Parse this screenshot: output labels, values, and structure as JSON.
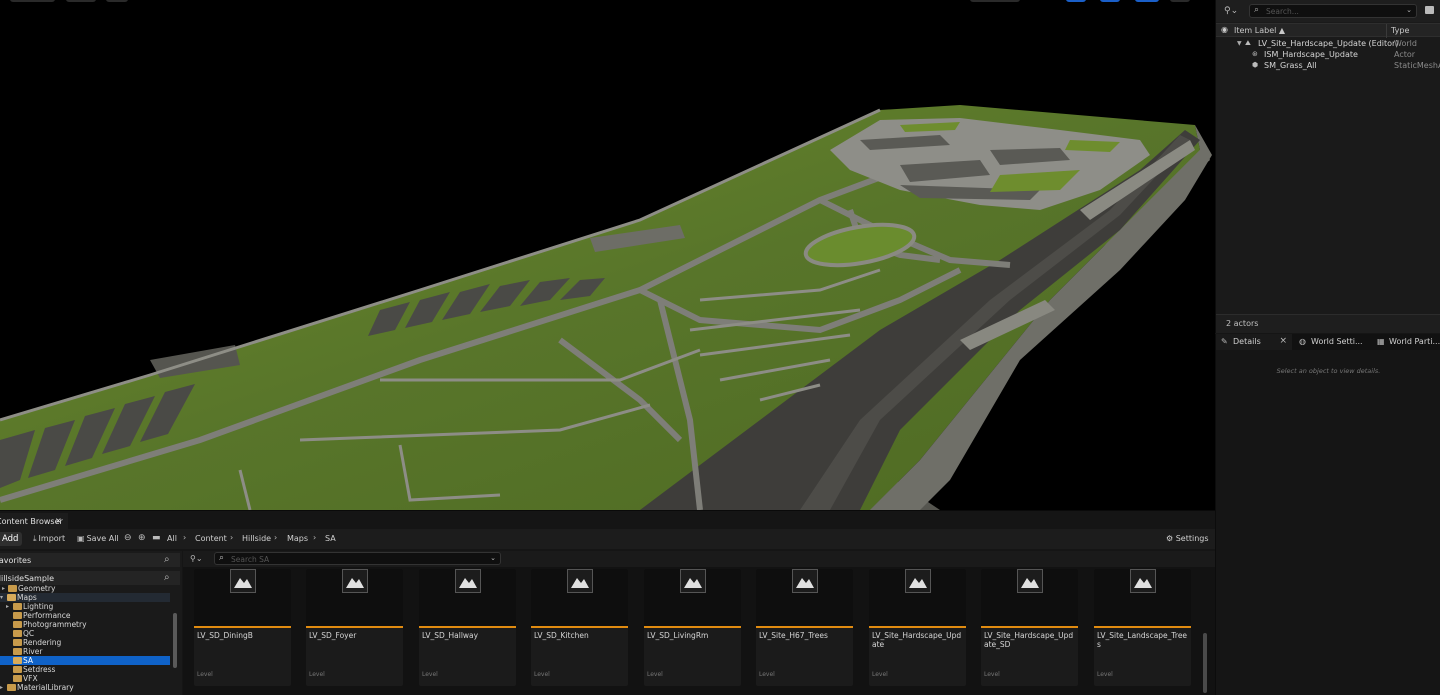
{
  "outliner": {
    "search_placeholder": "Search...",
    "col_label": "Item Label ▲",
    "col_type": "Type",
    "rows": [
      {
        "name": "LV_Site_Hardscape_Update (Editor)",
        "type": "World",
        "icon": "world-icon"
      },
      {
        "name": "ISM_Hardscape_Update",
        "type": "Actor",
        "icon": "actor-icon"
      },
      {
        "name": "SM_Grass_All",
        "type": "StaticMeshAc",
        "icon": "static-mesh-icon"
      }
    ],
    "footer": "2 actors"
  },
  "details": {
    "tabs": [
      {
        "label": "Details",
        "icon": "pencil-icon",
        "close": "×"
      },
      {
        "label": "World Setti...",
        "icon": "globe-icon"
      },
      {
        "label": "World Parti...",
        "icon": "grid-icon"
      }
    ],
    "empty_message": "Select an object to view details."
  },
  "content_browser": {
    "tab_title": "Content Browser",
    "tab_close": "×",
    "add_label": "Add",
    "import_label": "Import",
    "save_all_label": "Save All",
    "breadcrumbs": [
      "All",
      "Content",
      "Hillside",
      "Maps",
      "SA"
    ],
    "settings_label": "Settings",
    "search_placeholder": "Search SA",
    "favorites_label": "Favorites",
    "project_label": "HillsideSample",
    "tree": [
      {
        "name": "Geometry",
        "arrow": "▸",
        "selected": false
      },
      {
        "name": "Maps",
        "arrow": "▾",
        "selected": false,
        "open": true
      },
      {
        "name": "Lighting",
        "arrow": "▸",
        "selected": false
      },
      {
        "name": "Performance",
        "arrow": "",
        "selected": false
      },
      {
        "name": "Photogrammetry",
        "arrow": "",
        "selected": false
      },
      {
        "name": "QC",
        "arrow": "",
        "selected": false
      },
      {
        "name": "Rendering",
        "arrow": "",
        "selected": false
      },
      {
        "name": "River",
        "arrow": "",
        "selected": false
      },
      {
        "name": "SA",
        "arrow": "",
        "selected": true
      },
      {
        "name": "Setdress",
        "arrow": "",
        "selected": false
      },
      {
        "name": "VFX",
        "arrow": "",
        "selected": false
      },
      {
        "name": "MaterialLibrary",
        "arrow": "▸",
        "selected": false
      }
    ],
    "assets": [
      {
        "name": "LV_SD_DiningB",
        "type": "Level"
      },
      {
        "name": "LV_SD_Foyer",
        "type": "Level"
      },
      {
        "name": "LV_SD_Hallway",
        "type": "Level"
      },
      {
        "name": "LV_SD_Kitchen",
        "type": "Level"
      },
      {
        "name": "LV_SD_LivingRm",
        "type": "Level"
      },
      {
        "name": "LV_Site_H67_Trees",
        "type": "Level"
      },
      {
        "name": "LV_Site_Hardscape_Update",
        "type": "Level"
      },
      {
        "name": "LV_Site_Hardscape_Update_SD",
        "type": "Level"
      },
      {
        "name": "LV_Site_Landscape_Trees",
        "type": "Level"
      }
    ]
  },
  "colors": {
    "accent_blue": "#0f62c8",
    "level_bar": "#e08b10",
    "folder": "#c79a4a",
    "grass": "#5b7a22",
    "road": "#3a3a3a"
  }
}
